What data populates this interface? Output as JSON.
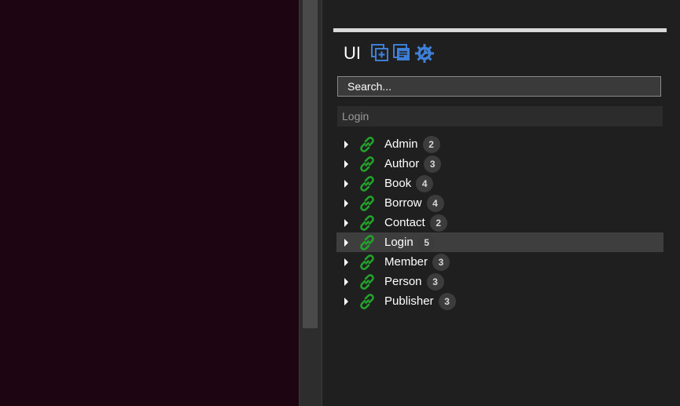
{
  "panel": {
    "title": "UI",
    "toolbar_icons": [
      "add-window-icon",
      "windows-icon",
      "gear-wrench-icon"
    ],
    "accent_color": "#3e7fd6",
    "link_icon_color": "#22a32a"
  },
  "search": {
    "placeholder": "Search..."
  },
  "section": {
    "header": "Login"
  },
  "tree": {
    "items": [
      {
        "label": "Admin",
        "count": "2"
      },
      {
        "label": "Author",
        "count": "3"
      },
      {
        "label": "Book",
        "count": "4"
      },
      {
        "label": "Borrow",
        "count": "4"
      },
      {
        "label": "Contact",
        "count": "2"
      },
      {
        "label": "Login",
        "count": "5",
        "selected": true
      },
      {
        "label": "Member",
        "count": "3"
      },
      {
        "label": "Person",
        "count": "3"
      },
      {
        "label": "Publisher",
        "count": "3"
      }
    ]
  }
}
